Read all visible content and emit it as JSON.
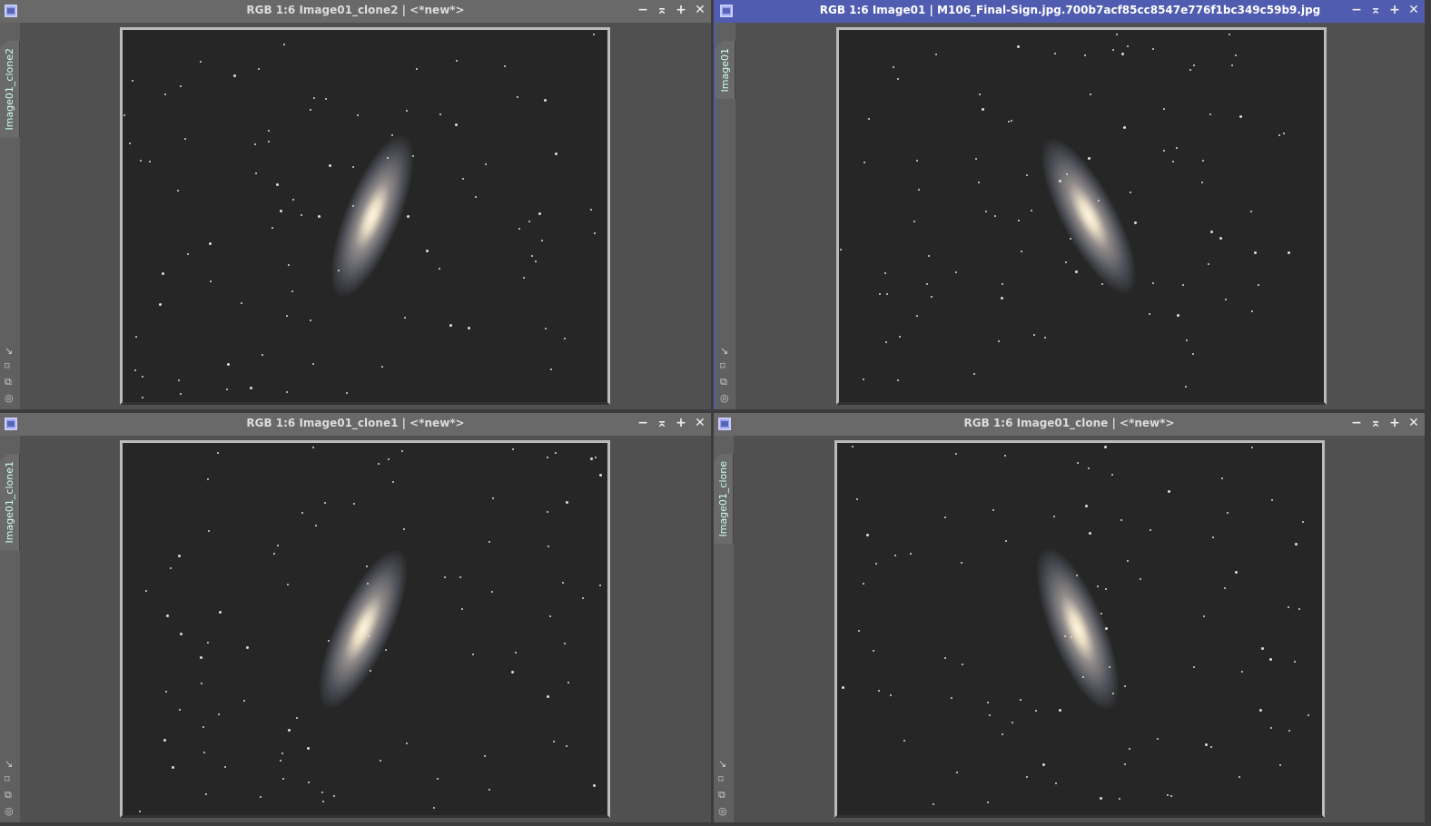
{
  "windows": [
    {
      "title": "RGB 1:6 Image01_clone2 | <*new*>",
      "tab": "Image01_clone2",
      "active": false
    },
    {
      "title": "RGB 1:6 Image01 | M106_Final-Sign.jpg.700b7acf85cc8547e776f1bc349c59b9.jpg",
      "tab": "Image01",
      "active": true
    },
    {
      "title": "RGB 1:6 Image01_clone1 | <*new*>",
      "tab": "Image01_clone1",
      "active": false
    },
    {
      "title": "RGB 1:6 Image01_clone | <*new*>",
      "tab": "Image01_clone",
      "active": false
    }
  ],
  "controls": {
    "minimize": "−",
    "shade": "⌅",
    "maximize": "+",
    "close": "✕"
  },
  "tools": [
    "↘",
    "⌑",
    "⧉",
    "◎"
  ],
  "colors": {
    "active_title": "#4f5cb0",
    "inactive_title": "#696969"
  }
}
